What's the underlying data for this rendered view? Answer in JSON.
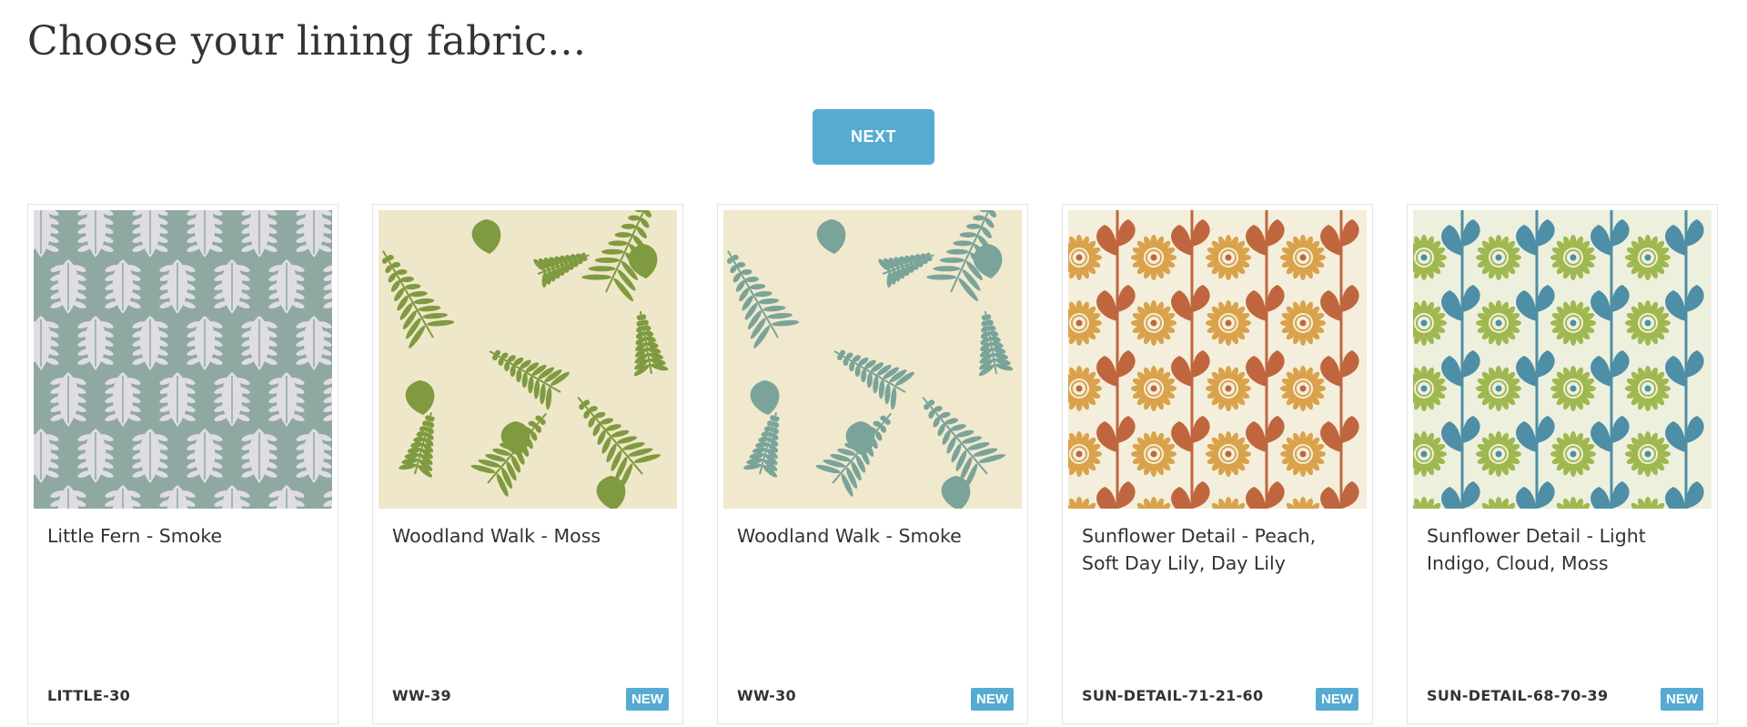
{
  "page": {
    "title": "Choose your lining fabric...",
    "next_label": "NEXT",
    "accent_color": "#56abd3"
  },
  "fabrics": [
    {
      "name": "Little Fern - Smoke",
      "code": "LITTLE-30",
      "badge": "",
      "pattern": "leaf-diamond",
      "background": "#8fa9a2",
      "motif": "#dfdde3"
    },
    {
      "name": "Woodland Walk - Moss",
      "code": "WW-39",
      "badge": "NEW",
      "pattern": "ferns",
      "background": "#efe7c9",
      "motif": "#7f9a3f"
    },
    {
      "name": "Woodland Walk - Smoke",
      "code": "WW-30",
      "badge": "NEW",
      "pattern": "ferns",
      "background": "#f0e9cd",
      "motif": "#7aa39a"
    },
    {
      "name": "Sunflower Detail - Peach, Soft Day Lily, Day Lily",
      "code": "SUN-DETAIL-71-21-60",
      "badge": "NEW",
      "pattern": "sunflower",
      "background": "#f3efdc",
      "motif": "#c0663e",
      "motif2": "#d9a24b"
    },
    {
      "name": "Sunflower Detail - Light Indigo, Cloud, Moss",
      "code": "SUN-DETAIL-68-70-39",
      "badge": "NEW",
      "pattern": "sunflower",
      "background": "#eef0de",
      "motif": "#4e8ea6",
      "motif2": "#9fb84f"
    }
  ]
}
